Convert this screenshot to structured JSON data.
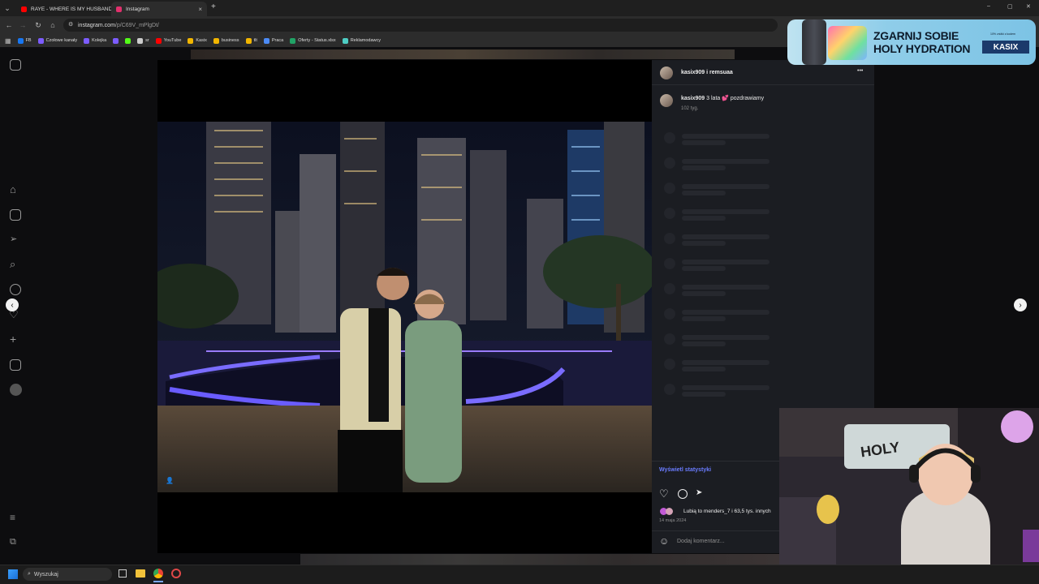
{
  "browser": {
    "tabs": [
      {
        "title": "RAYE - WHERE IS MY HUSBAND",
        "favicon_color": "#ff0000",
        "active": false
      },
      {
        "title": "Instagram",
        "favicon_color": "#e1306c",
        "active": true
      }
    ],
    "new_tab_label": "+",
    "close_label": "×",
    "url_domain": "instagram.com",
    "url_path": "/p/C69V_mPlgDt/",
    "window_controls": [
      "–",
      "▢",
      "✕"
    ]
  },
  "bookmarks": [
    {
      "label": "FB",
      "color": "#1877f2"
    },
    {
      "label": "Czołowe kanały",
      "color": "#7c5cff"
    },
    {
      "label": "Kolejka",
      "color": "#7c5cff"
    },
    {
      "label": "",
      "color": "#7c5cff"
    },
    {
      "label": "",
      "color": "#53fc18"
    },
    {
      "label": "sr",
      "color": "#cccccc"
    },
    {
      "label": "YouTube",
      "color": "#ff0000"
    },
    {
      "label": "Kasix",
      "color": "#f2b600"
    },
    {
      "label": "business",
      "color": "#f2b600"
    },
    {
      "label": "tlt",
      "color": "#f2b600"
    },
    {
      "label": "Praca",
      "color": "#4c8bf5"
    },
    {
      "label": "Oferty - Status.xlsx",
      "color": "#21a366"
    },
    {
      "label": "Reklamodawcy",
      "color": "#4ecdc4"
    }
  ],
  "post": {
    "author_header": "kasix909 i remsuaa",
    "more_label": "•••",
    "caption_user": "kasix909",
    "caption_text": "3 lata 💕 pozdrawiamy",
    "caption_time": "102 tyg.",
    "insights_label": "Wyświetl statystyki",
    "likes_text": "Lubią to menders_7 i 63,5 tys. innych",
    "date": "14 maja 2024",
    "comment_placeholder": "Dodaj komentarz..."
  },
  "ad": {
    "headline_line1": "ZGARNIJ SOBIE",
    "headline_line2": "HOLY HYDRATION",
    "code_label": "KASIX",
    "fine_print": "10% zniżki z kodem"
  },
  "taskbar": {
    "search_placeholder": "Wyszukaj"
  },
  "icons": {
    "prev": "‹",
    "next": "›",
    "heart": "♡",
    "comment": "◯",
    "share": "➤",
    "emoji": "☺",
    "search": "⌕"
  }
}
